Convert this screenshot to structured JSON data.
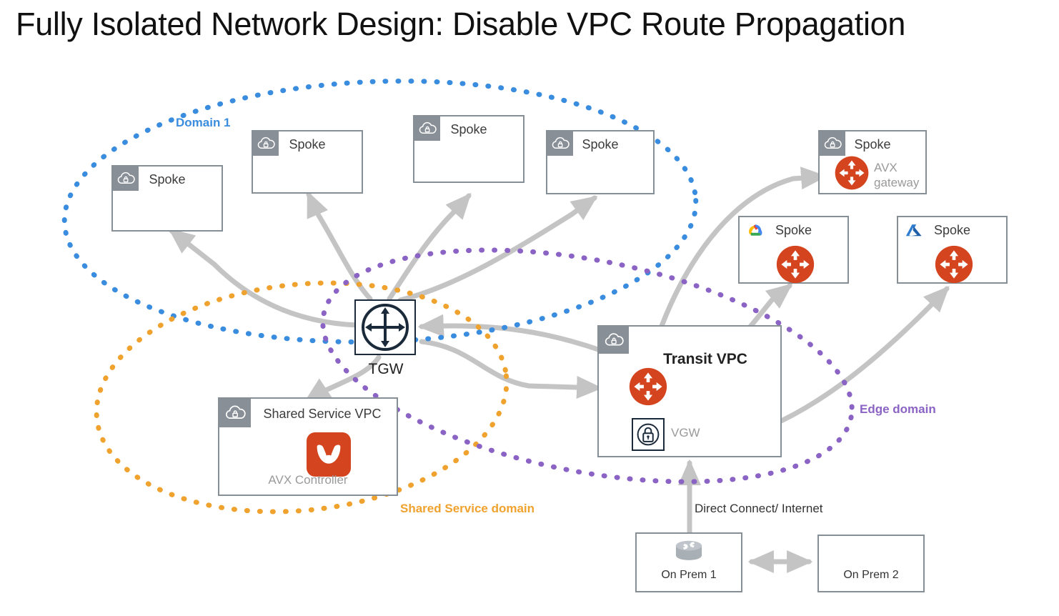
{
  "page": {
    "title": "Fully Isolated Network Design: Disable VPC Route Propagation",
    "background": "#ffffff"
  },
  "colors": {
    "domain1": "#3A8DDE",
    "shared_service_domain": "#F0A22E",
    "edge_domain": "#8A63C4",
    "aviatrix_orange": "#D4441E",
    "box_border": "#878F96",
    "vpc_badge": "#898F96",
    "arrow_gray": "#C4C4C4",
    "tgw_navy": "#1B2A3A",
    "muted_text": "#9a9a9a"
  },
  "domains": [
    {
      "id": "domain1",
      "label": "Domain 1",
      "color": "#3A8DDE",
      "style": "dotted-ellipse"
    },
    {
      "id": "shared",
      "label": "Shared Service domain",
      "color": "#F0A22E",
      "style": "dotted-ellipse"
    },
    {
      "id": "edge",
      "label": "Edge domain",
      "color": "#8A63C4",
      "style": "dotted-ellipse"
    }
  ],
  "nodes": {
    "spoke_aws_1": {
      "title": "Spoke",
      "cloud": "aws-vpc-lock-icon"
    },
    "spoke_aws_2": {
      "title": "Spoke",
      "cloud": "aws-vpc-lock-icon"
    },
    "spoke_aws_3": {
      "title": "Spoke",
      "cloud": "aws-vpc-lock-icon"
    },
    "spoke_aws_4": {
      "title": "Spoke",
      "cloud": "aws-vpc-lock-icon"
    },
    "spoke_aws_gw": {
      "title": "Spoke",
      "cloud": "aws-vpc-lock-icon",
      "subtitle": "AVX gateway",
      "gateway": "aviatrix-gateway-icon"
    },
    "spoke_gcp": {
      "title": "Spoke",
      "cloud": "google-cloud-icon",
      "gateway": "aviatrix-gateway-icon"
    },
    "spoke_azure": {
      "title": "Spoke",
      "cloud": "azure-icon",
      "gateway": "aviatrix-gateway-icon"
    },
    "tgw": {
      "label": "TGW",
      "icon": "transit-gateway-icon"
    },
    "shared_service_vpc": {
      "title": "Shared Service VPC",
      "cloud": "aws-vpc-lock-icon",
      "subtitle": "AVX Controller",
      "logo": "aviatrix-controller-icon"
    },
    "transit_vpc": {
      "title": "Transit VPC",
      "cloud": "aws-vpc-lock-icon",
      "gateway": "aviatrix-gateway-icon",
      "vgw_label": "VGW",
      "vgw_icon": "vpn-gateway-lock-icon"
    },
    "on_prem_1": {
      "label": "On Prem 1",
      "icon": "router-icon"
    },
    "on_prem_2": {
      "label": "On Prem 2"
    }
  },
  "connections": {
    "direct_connect_label": "Direct Connect/ Internet"
  }
}
